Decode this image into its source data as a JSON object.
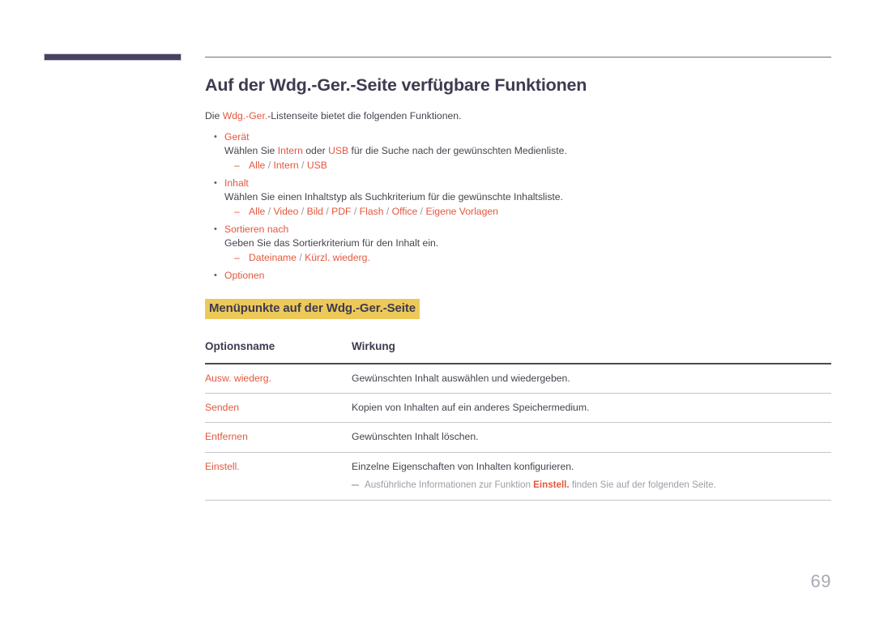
{
  "colors": {
    "accent": "#e4573d",
    "highlight_bg": "#edc95a",
    "heading": "#3d3b4f",
    "body": "#44444e",
    "tab_marker": "#454360",
    "page_number": "#a9a9b4"
  },
  "page": {
    "title": "Auf der Wdg.-Ger.-Seite verfügbare Funktionen",
    "intro_prefix": "Die ",
    "intro_accent": "Wdg.-Ger.",
    "intro_suffix": "-Listenseite bietet die folgenden Funktionen.",
    "number": "69"
  },
  "bullets": [
    {
      "title": "Gerät",
      "desc_prefix": "Wählen Sie ",
      "desc_accent1": "Intern",
      "desc_mid": " oder ",
      "desc_accent2": "USB",
      "desc_suffix": " für die Suche nach der gewünschten Medienliste.",
      "options": "Alle / Intern / USB"
    },
    {
      "title": "Inhalt",
      "desc": "Wählen Sie einen Inhaltstyp als Suchkriterium für die gewünschte Inhaltsliste.",
      "options": "Alle / Video / Bild / PDF / Flash / Office / Eigene Vorlagen"
    },
    {
      "title": "Sortieren nach",
      "desc": "Geben Sie das Sortierkriterium für den Inhalt ein.",
      "options": "Dateiname / Kürzl. wiederg."
    },
    {
      "title": "Optionen"
    }
  ],
  "subheading": "Menüpunkte auf der Wdg.-Ger.-Seite",
  "table": {
    "headers": {
      "name": "Optionsname",
      "effect": "Wirkung"
    },
    "rows": [
      {
        "name": "Ausw. wiederg.",
        "effect": "Gewünschten Inhalt auswählen und wiedergeben."
      },
      {
        "name": "Senden",
        "effect": "Kopien von Inhalten auf ein anderes Speichermedium."
      },
      {
        "name": "Entfernen",
        "effect": "Gewünschten Inhalt löschen."
      },
      {
        "name": "Einstell.",
        "effect": "Einzelne Eigenschaften von Inhalten konfigurieren.",
        "note_prefix": "Ausführliche Informationen zur Funktion ",
        "note_accent": "Einstell.",
        "note_suffix": " finden Sie auf der folgenden Seite."
      }
    ]
  }
}
